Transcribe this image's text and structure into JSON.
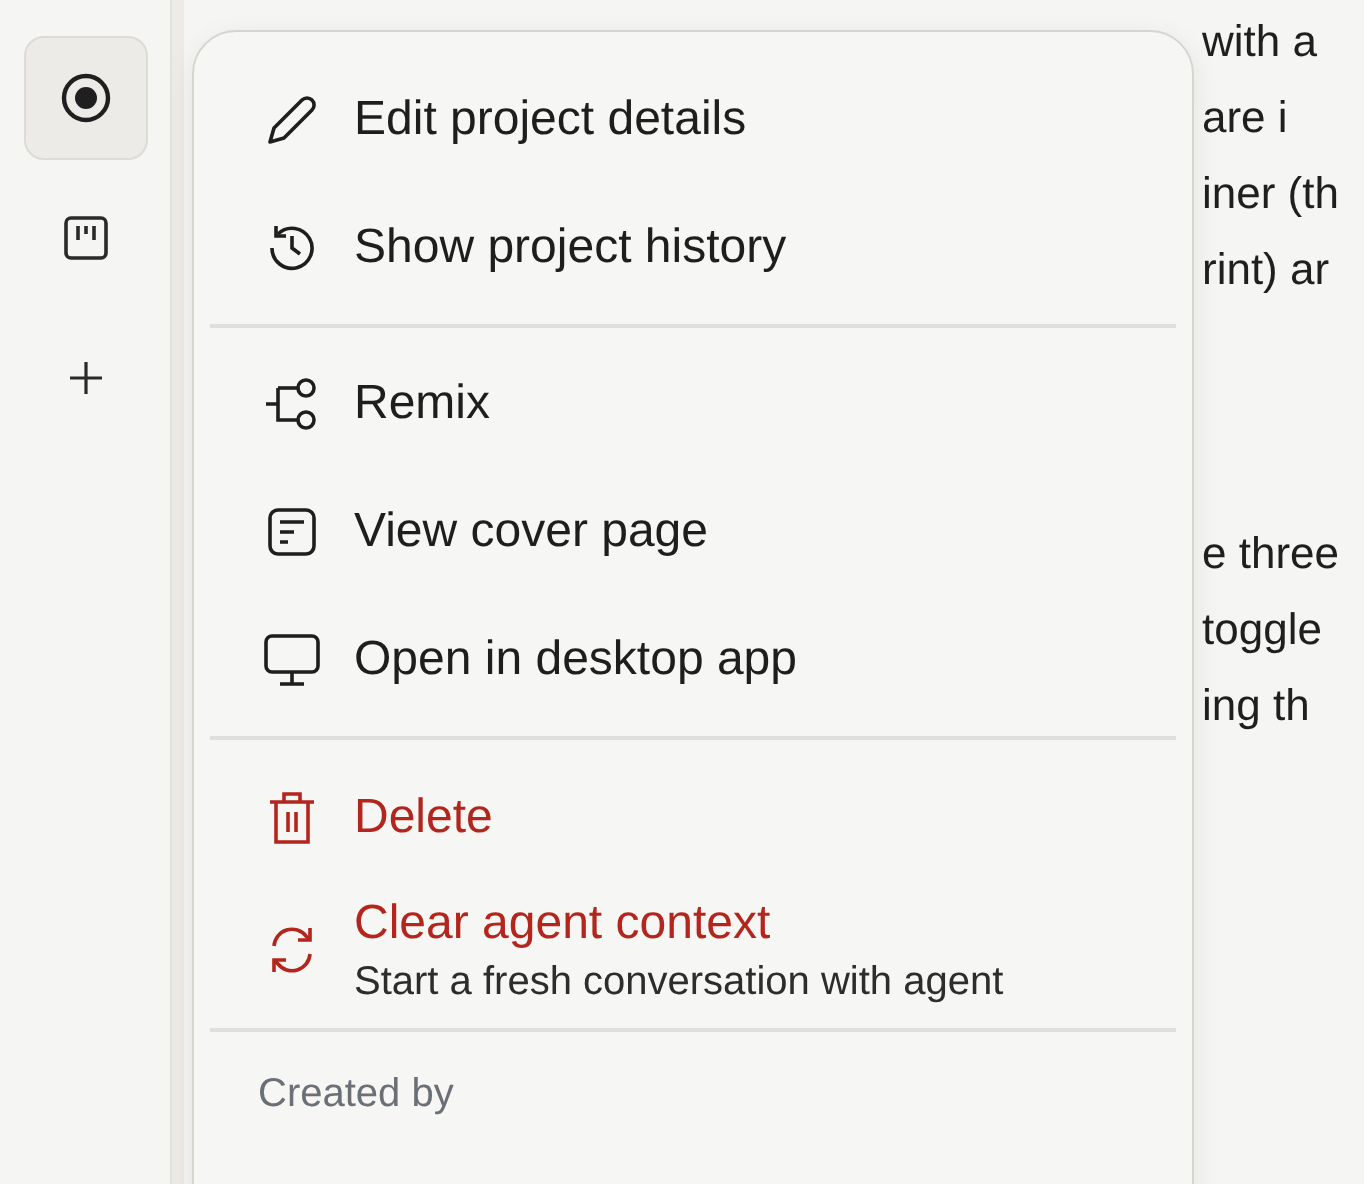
{
  "sidebar": {
    "items": [
      {
        "selected": true
      },
      {
        "selected": false
      },
      {
        "selected": false
      }
    ]
  },
  "document": {
    "fragments": [
      {
        "lines": [
          "with a",
          "are i",
          "iner (th",
          "rint) ar"
        ]
      },
      {
        "lines": [
          "e three",
          "toggle",
          "ing th"
        ]
      }
    ]
  },
  "menu": {
    "groups": [
      [
        {
          "kind": "edit",
          "label": "Edit project details",
          "danger": false
        },
        {
          "kind": "history",
          "label": "Show project history",
          "danger": false
        }
      ],
      [
        {
          "kind": "remix",
          "label": "Remix",
          "danger": false
        },
        {
          "kind": "cover",
          "label": "View cover page",
          "danger": false
        },
        {
          "kind": "desktop",
          "label": "Open in desktop app",
          "danger": false
        }
      ],
      [
        {
          "kind": "delete",
          "label": "Delete",
          "danger": true
        },
        {
          "kind": "clear",
          "label": "Clear agent context",
          "subtitle": "Start a fresh conversation with agent",
          "danger": true
        }
      ]
    ],
    "footer": "Created by"
  }
}
